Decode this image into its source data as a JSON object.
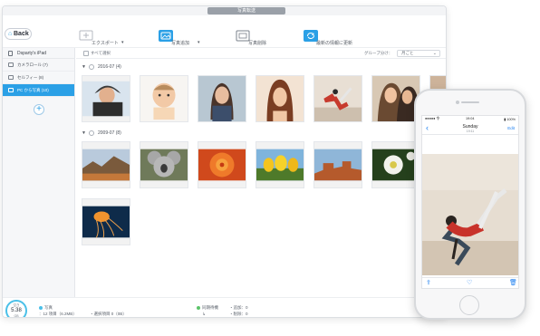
{
  "window": {
    "title": "写真転送"
  },
  "toolbar": {
    "back_label": "Back",
    "export_label": "エクスポート",
    "add_photo_label": "写真追加",
    "delete_photo_label": "写真削除",
    "refresh_label": "最新の情報に更新"
  },
  "sidebar": {
    "device_name": "Dsparty's iPad",
    "items": [
      {
        "label": "カメラロール (7)"
      },
      {
        "label": "セルフィー (8)"
      },
      {
        "label": "PC から写真 (10)"
      }
    ]
  },
  "filter": {
    "select_all_label": "すべて選択",
    "group_by_label": "グループ分け：",
    "group_by_value": "月ごと"
  },
  "groups": [
    {
      "label": "2016-07 (4)"
    },
    {
      "label": "2009-07 (8)"
    }
  ],
  "status": {
    "storage_label": "空き",
    "storage_value": "5.38",
    "storage_unit": "GB",
    "photos_label": "写真",
    "photos_count": "：12 項目（6.2MB）",
    "selected": "・選択項目 0（0B）",
    "syncing_label": "同期待機",
    "added": "・追加：0",
    "deleted": "・削除：0"
  },
  "phone": {
    "carrier": "●●●●● 令",
    "time": "19:04",
    "battery": "▮ 100%",
    "nav_title": "Sunday",
    "nav_subtitle": "19:11",
    "nav_edit": "Edit"
  },
  "colors": {
    "accent": "#2ba0e6",
    "sidebar_active": "#2ba0e6",
    "ios_blue": "#1d7ff0",
    "storage_ring": "#4bc0e8"
  }
}
